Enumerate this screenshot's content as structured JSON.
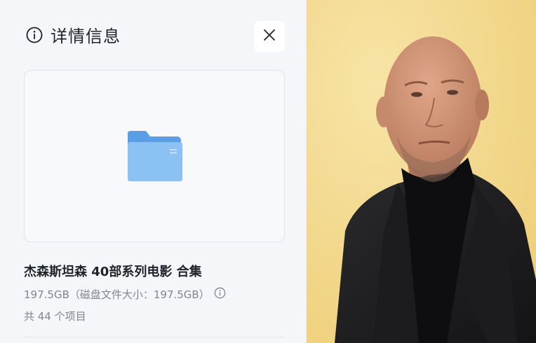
{
  "panel": {
    "title": "详情信息",
    "icons": {
      "info": "info-circle-icon",
      "close": "close-icon",
      "folder": "folder-icon",
      "size_info": "info-circle-icon"
    }
  },
  "item": {
    "name": "杰森斯坦森 40部系列电影 合集",
    "size_text": "197.5GB（磁盘文件大小：197.5GB）",
    "count_text": "共 44 个项目"
  },
  "colors": {
    "panel_bg": "#f5f6f9",
    "folder_blue": "#7fb7ef",
    "text_primary": "#1f2329",
    "text_secondary": "#80858f",
    "photo_bg": "#f3d88c"
  }
}
